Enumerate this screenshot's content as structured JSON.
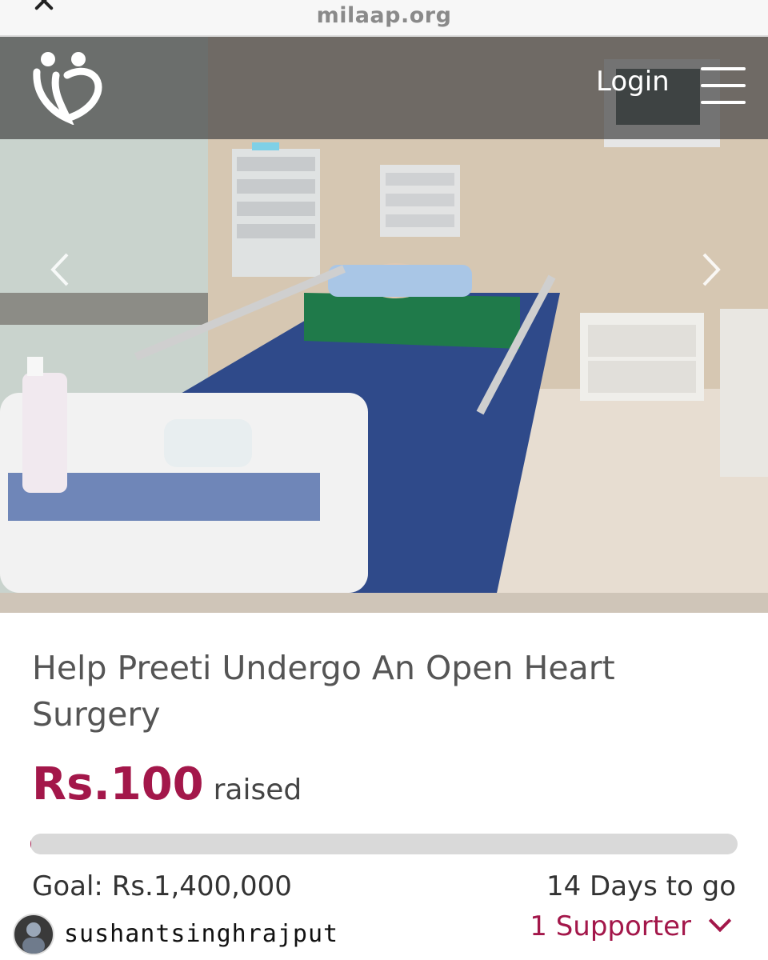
{
  "browser": {
    "url": "milaap.org"
  },
  "header": {
    "login_label": "Login"
  },
  "campaign": {
    "title": "Help Preeti Undergo An Open Heart Surgery",
    "raised_amount": "Rs.100",
    "raised_label": "raised",
    "goal": "Goal: Rs.1,400,000",
    "days_left": "14 Days to go",
    "supporters": "1 Supporter",
    "progress_fraction": 0.0001
  },
  "watermark": {
    "username": "sushantsinghrajput"
  },
  "colors": {
    "brand": "#a3174a",
    "progress_track": "#d9d9d9"
  },
  "icons": {
    "logo": "milaap-logo-icon",
    "menu": "hamburger-menu-icon",
    "prev": "chevron-left-icon",
    "next": "chevron-right-icon",
    "expand": "chevron-down-icon"
  }
}
